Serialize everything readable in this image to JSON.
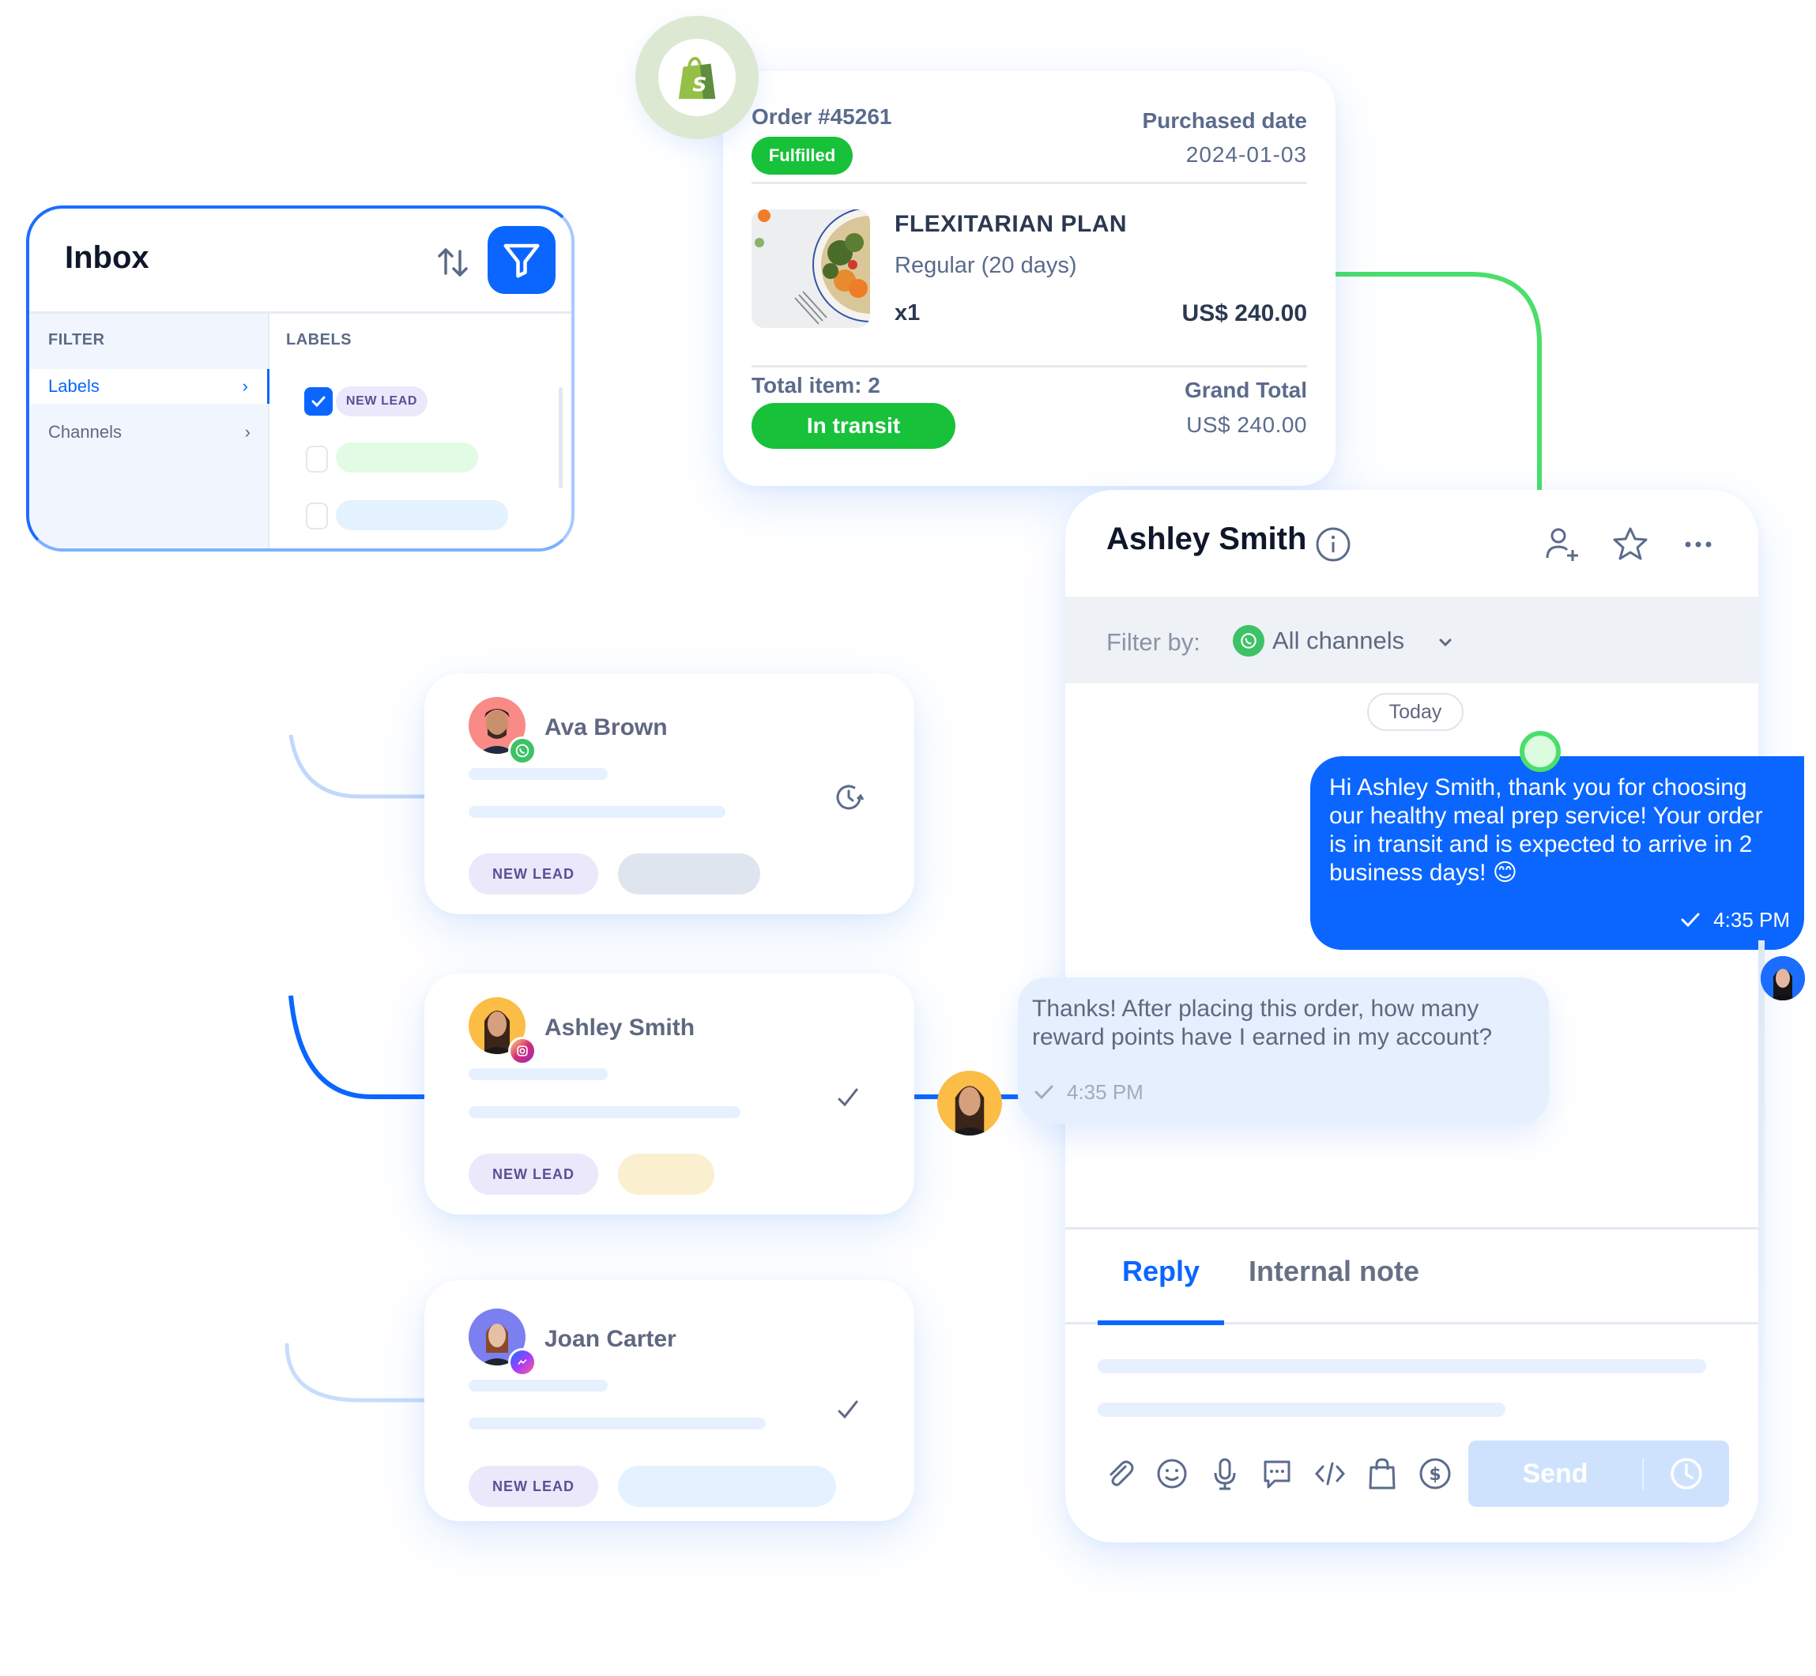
{
  "colors": {
    "primary": "#0a66ff",
    "success": "#17c13a",
    "connector_green": "#4ade6b",
    "label_bg": "#ebe8fb",
    "label_text": "#5a4f95"
  },
  "inbox": {
    "title": "Inbox",
    "sort_icon": "sort-arrows-icon",
    "filter_icon": "funnel-icon",
    "filter_header": "FILTER",
    "labels_header": "LABELS",
    "filter_items": [
      {
        "label": "Labels",
        "active": true
      },
      {
        "label": "Channels",
        "active": false
      }
    ],
    "label_options": [
      {
        "label": "NEW LEAD",
        "checked": true
      },
      {
        "label": "",
        "checked": false
      },
      {
        "label": "",
        "checked": false
      }
    ]
  },
  "order": {
    "integration_icon": "shopify-icon",
    "order_number": "Order #45261",
    "fulfillment_status": "Fulfilled",
    "purchased_label": "Purchased date",
    "purchased_date": "2024-01-03",
    "product": {
      "name": "FLEXITARIAN PLAN",
      "variant": "Regular (20 days)",
      "quantity": "x1",
      "price": "US$ 240.00"
    },
    "total_items": "Total item: 2",
    "shipping_status": "In transit",
    "grand_total_label": "Grand Total",
    "grand_total": "US$ 240.00"
  },
  "contacts": [
    {
      "name": "Ava Brown",
      "channel": "whatsapp",
      "status_icon": "snooze-clock-icon",
      "label": "NEW LEAD"
    },
    {
      "name": "Ashley Smith",
      "channel": "instagram",
      "status_icon": "check-icon",
      "label": "NEW LEAD"
    },
    {
      "name": "Joan Carter",
      "channel": "messenger",
      "status_icon": "check-icon",
      "label": "NEW LEAD"
    }
  ],
  "chat": {
    "contact_name": "Ashley Smith",
    "header_icons": [
      "info-icon",
      "assign-user-icon",
      "star-icon",
      "more-icon"
    ],
    "filter_label": "Filter by:",
    "filter_value": "All channels",
    "date_divider": "Today",
    "messages": [
      {
        "direction": "outgoing",
        "text": "Hi Ashley Smith, thank you for choosing our healthy meal prep service!  Your order is in transit and is expected to arrive in 2 business days! 😊",
        "time": "4:35 PM"
      },
      {
        "direction": "incoming",
        "text": "Thanks! After placing this order, how many reward points have I earned in my account?",
        "time": "4:35 PM"
      }
    ],
    "tabs": [
      {
        "label": "Reply",
        "active": true
      },
      {
        "label": "Internal note",
        "active": false
      }
    ],
    "toolbar": [
      "attachment-icon",
      "emoji-icon",
      "microphone-icon",
      "quick-reply-icon",
      "code-icon",
      "shopping-bag-icon",
      "payment-icon"
    ],
    "send_label": "Send",
    "schedule_icon": "clock-icon"
  }
}
